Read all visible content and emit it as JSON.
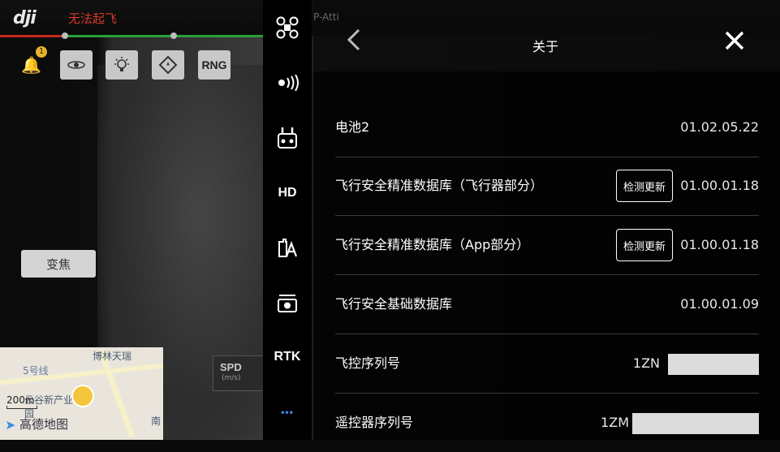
{
  "app": {
    "logo": "dji",
    "status": "无法起飞"
  },
  "left_toolbar": {
    "rng_label": "RNG",
    "bell_badge": "1"
  },
  "zoom_button": "变焦",
  "mini_map": {
    "labels": [
      "博林天瑞",
      "5号线",
      "云谷新产业园",
      "南"
    ],
    "scale": "200m",
    "logo": "高德地图"
  },
  "spd": {
    "label": "SPD",
    "unit": "(m/s)"
  },
  "side_menu": [
    {
      "icon": "drone-icon",
      "label": ""
    },
    {
      "icon": "signal-icon",
      "label": ""
    },
    {
      "icon": "remote-controller-icon",
      "label": ""
    },
    {
      "icon": "hd-icon",
      "label": "HD"
    },
    {
      "icon": "battery-icon",
      "label": ""
    },
    {
      "icon": "camera-icon",
      "label": ""
    },
    {
      "icon": "rtk-icon",
      "label": "RTK"
    },
    {
      "icon": "more-icon",
      "label": "•••"
    }
  ],
  "about_panel": {
    "title": "关于",
    "rows": [
      {
        "label": "电池2",
        "value": "01.02.05.22"
      },
      {
        "label": "飞行安全精准数据库（飞行器部分）",
        "value": "01.00.01.18",
        "button": "检测更新"
      },
      {
        "label": "飞行安全精准数据库（App部分）",
        "value": "01.00.01.18",
        "button": "检测更新"
      },
      {
        "label": "飞行安全基础数据库",
        "value": "01.00.01.09"
      },
      {
        "label": "飞控序列号",
        "value": "1ZN"
      },
      {
        "label": "遥控器序列号",
        "value": "1ZM"
      }
    ]
  },
  "colors": {
    "status_red": "#d93a2a",
    "line_green": "#29a03a",
    "accent_blue": "#3a8ee6",
    "bell": "#e8b42a"
  }
}
